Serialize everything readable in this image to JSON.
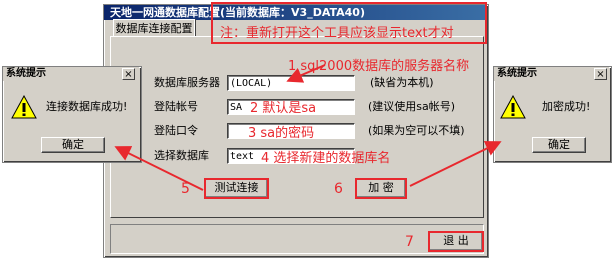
{
  "main_window": {
    "title": "天地一网通数据库配置(当前数据库：V3_DATA40)",
    "tab_label": "数据库连接配置",
    "fields": [
      {
        "label": "数据库服务器",
        "value": "(LOCAL)",
        "hint": "(缺省为本机)"
      },
      {
        "label": "登陆帐号",
        "value": "SA",
        "hint": "(建议使用sa帐号)"
      },
      {
        "label": "登陆口令",
        "value": "",
        "hint": "(如果为空可以不填)"
      },
      {
        "label": "选择数据库",
        "value": "text",
        "hint": ""
      }
    ],
    "test_button": "测试连接",
    "encrypt_button": "加  密",
    "exit_button": "退  出"
  },
  "dialog_left": {
    "title": "系统提示",
    "close": "×",
    "message": "连接数据库成功!",
    "ok_button": "确定"
  },
  "dialog_right": {
    "title": "系统提示",
    "close": "×",
    "message": "加密成功!",
    "ok_button": "确定"
  },
  "annotations": {
    "note": "注：重新打开这个工具应该显示text才对",
    "a1": "1 sql2000数据库的服务器名称",
    "a2": "2 默认是sa",
    "a3": "3 sa的密码",
    "a4": "4 选择新建的数据库名",
    "n5": "5",
    "n6": "6",
    "n7": "7"
  },
  "colors": {
    "annotation_red": "#e8282e",
    "titlebar_blue": "#0a246a",
    "window_gray": "#d4d0c8"
  }
}
